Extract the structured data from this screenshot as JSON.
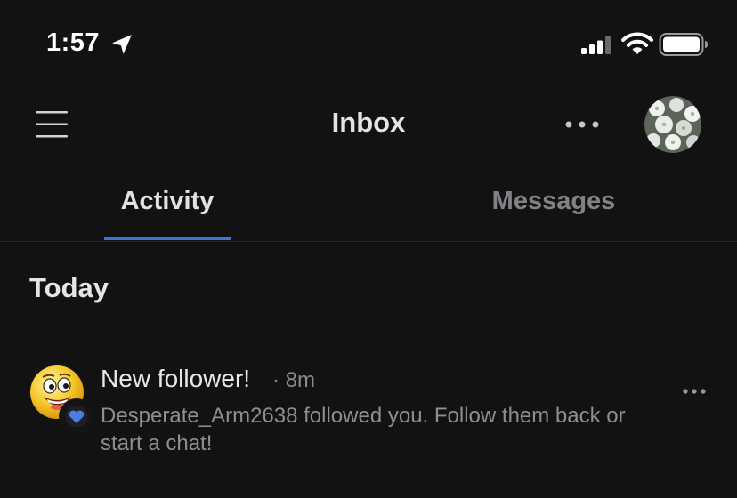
{
  "status_bar": {
    "time": "1:57",
    "icons": [
      "location-arrow-icon",
      "cellular-signal-icon",
      "wifi-icon",
      "battery-icon"
    ]
  },
  "header": {
    "title": "Inbox",
    "menu_icon": "hamburger-menu-icon",
    "more_icon": "more-horizontal-icon",
    "avatar": "user-avatar"
  },
  "tabs": [
    {
      "label": "Activity",
      "active": true
    },
    {
      "label": "Messages",
      "active": false
    }
  ],
  "sections": [
    {
      "title": "Today",
      "items": [
        {
          "title": "New follower!",
          "time": "· 8m",
          "body": "Desperate_Arm2638 followed you. Follow them back or start a chat!",
          "icons": [
            "emoji-avatar",
            "heart-badge-icon",
            "row-more-icon"
          ]
        }
      ]
    }
  ],
  "colors": {
    "background": "#121213",
    "accent": "#3a76d8",
    "text_primary": "#e6e6e8",
    "text_secondary": "#8e8e92"
  }
}
